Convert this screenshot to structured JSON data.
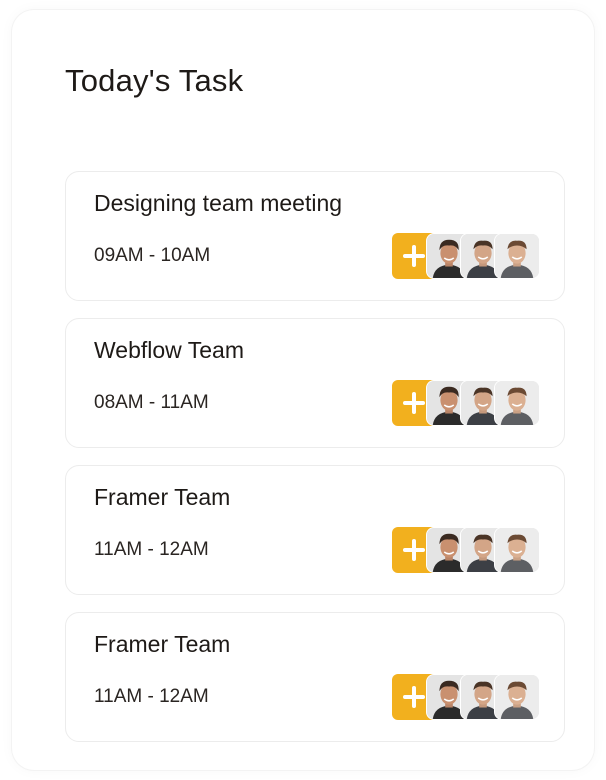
{
  "header": {
    "title": "Today's Task"
  },
  "colors": {
    "accent": "#f2b01e",
    "text": "#1e1a17",
    "card_border": "#ececec"
  },
  "tasks": [
    {
      "name": "Designing team meeting",
      "time": "09AM - 10AM",
      "add_icon": "plus-icon",
      "attendees": [
        "avatar-person-1",
        "avatar-person-2",
        "avatar-person-3"
      ]
    },
    {
      "name": "Webflow Team",
      "time": "08AM - 11AM",
      "add_icon": "plus-icon",
      "attendees": [
        "avatar-person-1",
        "avatar-person-2",
        "avatar-person-3"
      ]
    },
    {
      "name": "Framer Team",
      "time": "11AM - 12AM",
      "add_icon": "plus-icon",
      "attendees": [
        "avatar-person-1",
        "avatar-person-2",
        "avatar-person-3"
      ]
    },
    {
      "name": "Framer Team",
      "time": "11AM - 12AM",
      "add_icon": "plus-icon",
      "attendees": [
        "avatar-person-1",
        "avatar-person-2",
        "avatar-person-3"
      ]
    }
  ]
}
